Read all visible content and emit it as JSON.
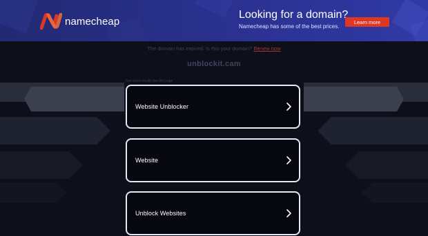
{
  "banner": {
    "logo_text": "namecheap",
    "promo_title": "Looking for a domain?",
    "promo_subtitle": "Namecheap has some of the best prices.",
    "cta_label": "Learn more",
    "colors": {
      "cta": "#de3723",
      "logo_mark": "#de3723"
    }
  },
  "notice": {
    "text": "The domain has expired. Is this your domain?",
    "link_text": "Renew now"
  },
  "domain": "unblockit.cam",
  "results": {
    "label": "See more results like this page",
    "items": [
      {
        "label": "Website Unblocker",
        "icon": "chevron-right-icon"
      },
      {
        "label": "Website",
        "icon": "chevron-right-icon"
      },
      {
        "label": "Unblock Websites",
        "icon": "chevron-right-icon"
      }
    ]
  }
}
